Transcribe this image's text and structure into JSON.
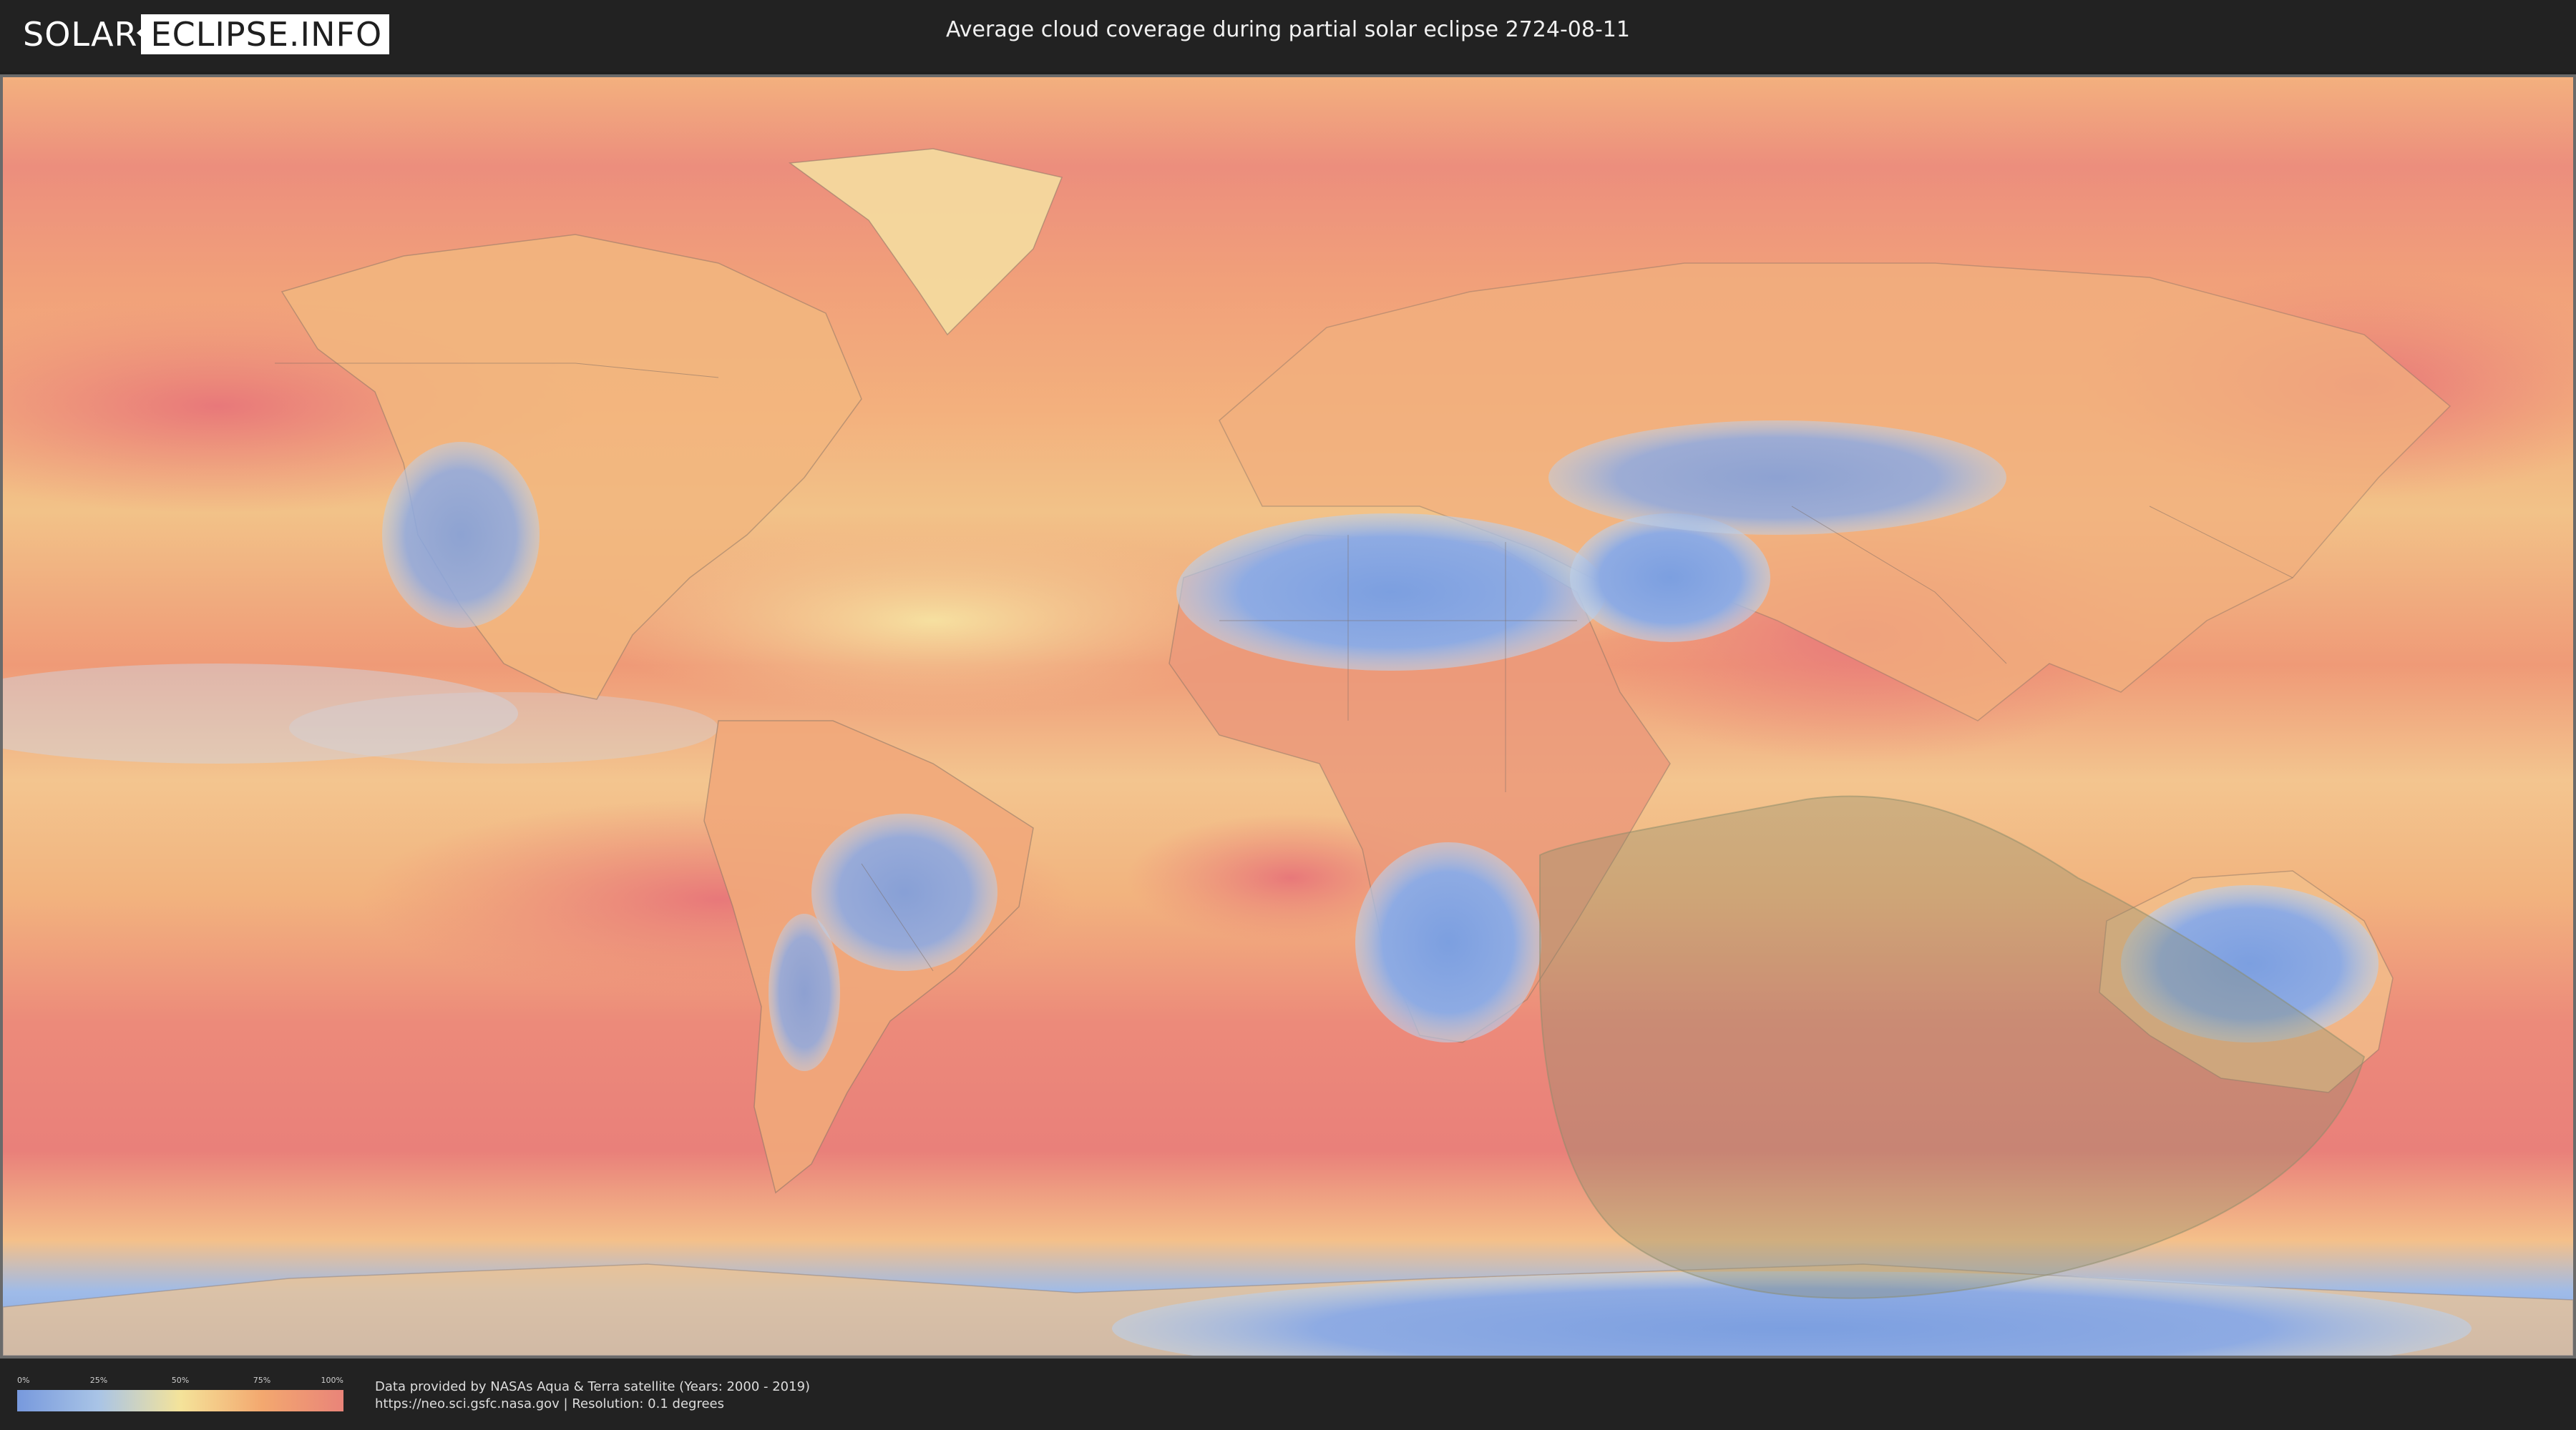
{
  "header": {
    "logo_left": "SOLAR",
    "logo_right": "ECLIPSE.INFO",
    "title": "Average cloud coverage during partial solar eclipse 2724-08-11"
  },
  "map": {
    "type": "world cloud coverage map",
    "projection": "equirectangular",
    "eclipse_overlay_color": "#8c8c6a"
  },
  "legend": {
    "ticks": [
      "0%",
      "25%",
      "50%",
      "75%",
      "100%"
    ],
    "colors": [
      "#7799dd",
      "#a9c4e6",
      "#f4e39a",
      "#f3a86f",
      "#e98479"
    ]
  },
  "footer": {
    "credit_line1": "Data provided by NASAs Aqua & Terra satellite (Years: 2000 - 2019)",
    "credit_line2": "https://neo.sci.gsfc.nasa.gov | Resolution: 0.1 degrees"
  }
}
